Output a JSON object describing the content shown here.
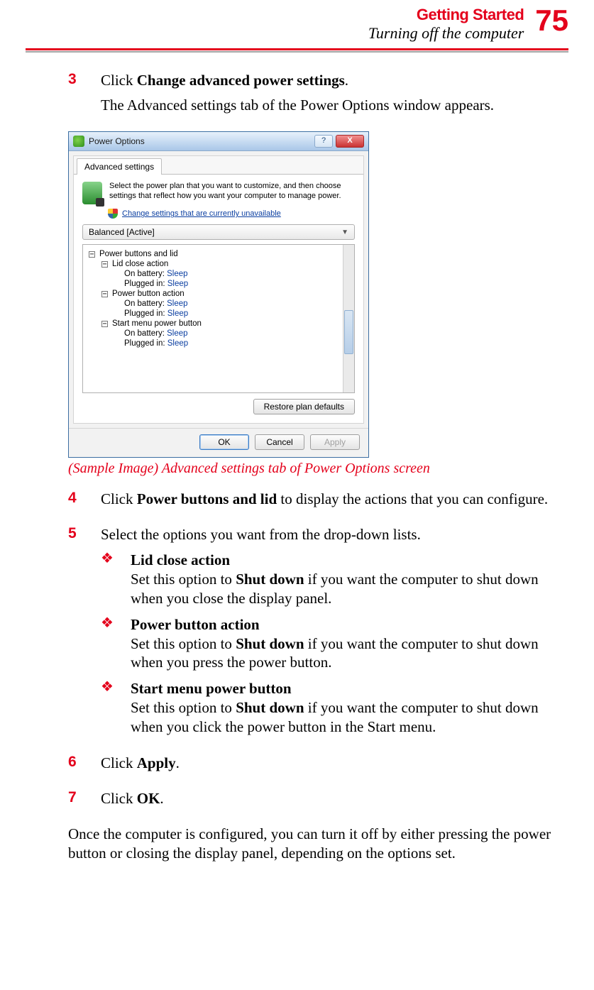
{
  "header": {
    "chapter": "Getting Started",
    "section": "Turning off the computer",
    "page_number": "75"
  },
  "steps": {
    "s3": {
      "num": "3",
      "text_pre": "Click ",
      "bold": "Change advanced power settings",
      "text_post": ".",
      "followup": "The Advanced settings tab of the Power Options window appears."
    },
    "caption": "(Sample Image) Advanced settings tab of Power Options screen",
    "s4": {
      "num": "4",
      "text_pre": "Click ",
      "bold": "Power buttons and lid",
      "text_post": " to display the actions that you can configure."
    },
    "s5": {
      "num": "5",
      "text": "Select the options you want from the drop-down lists.",
      "bullets": [
        {
          "title": "Lid close action",
          "text_pre": "Set this option to ",
          "bold": "Shut down",
          "text_post": " if you want the computer to shut down when you close the display panel."
        },
        {
          "title": "Power button action",
          "text_pre": "Set this option to ",
          "bold": "Shut down",
          "text_post": " if you want the computer to shut down when you press the power button."
        },
        {
          "title": "Start menu power button",
          "text_pre": "Set this option to ",
          "bold": "Shut down",
          "text_post": " if you want the computer to shut down when you click the power button in the Start menu."
        }
      ]
    },
    "s6": {
      "num": "6",
      "text_pre": "Click ",
      "bold": "Apply",
      "text_post": "."
    },
    "s7": {
      "num": "7",
      "text_pre": "Click ",
      "bold": "OK",
      "text_post": "."
    }
  },
  "closing": "Once the computer is configured, you can turn it off by either pressing the power button or closing the display panel, depending on the options set.",
  "dialog": {
    "title": "Power Options",
    "help": "?",
    "close": "X",
    "tab": "Advanced settings",
    "intro": "Select the power plan that you want to customize, and then choose settings that reflect how you want your computer to manage power.",
    "link": "Change settings that are currently unavailable",
    "plan": "Balanced [Active]",
    "tree": {
      "root": "Power buttons and lid",
      "groups": [
        {
          "name": "Lid close action",
          "rows": [
            {
              "label": "On battery:",
              "value": "Sleep"
            },
            {
              "label": "Plugged in:",
              "value": "Sleep"
            }
          ]
        },
        {
          "name": "Power button action",
          "rows": [
            {
              "label": "On battery:",
              "value": "Sleep"
            },
            {
              "label": "Plugged in:",
              "value": "Sleep"
            }
          ]
        },
        {
          "name": "Start menu power button",
          "rows": [
            {
              "label": "On battery:",
              "value": "Sleep"
            },
            {
              "label": "Plugged in:",
              "value": "Sleep"
            }
          ]
        }
      ]
    },
    "restore": "Restore plan defaults",
    "ok": "OK",
    "cancel": "Cancel",
    "apply": "Apply"
  }
}
